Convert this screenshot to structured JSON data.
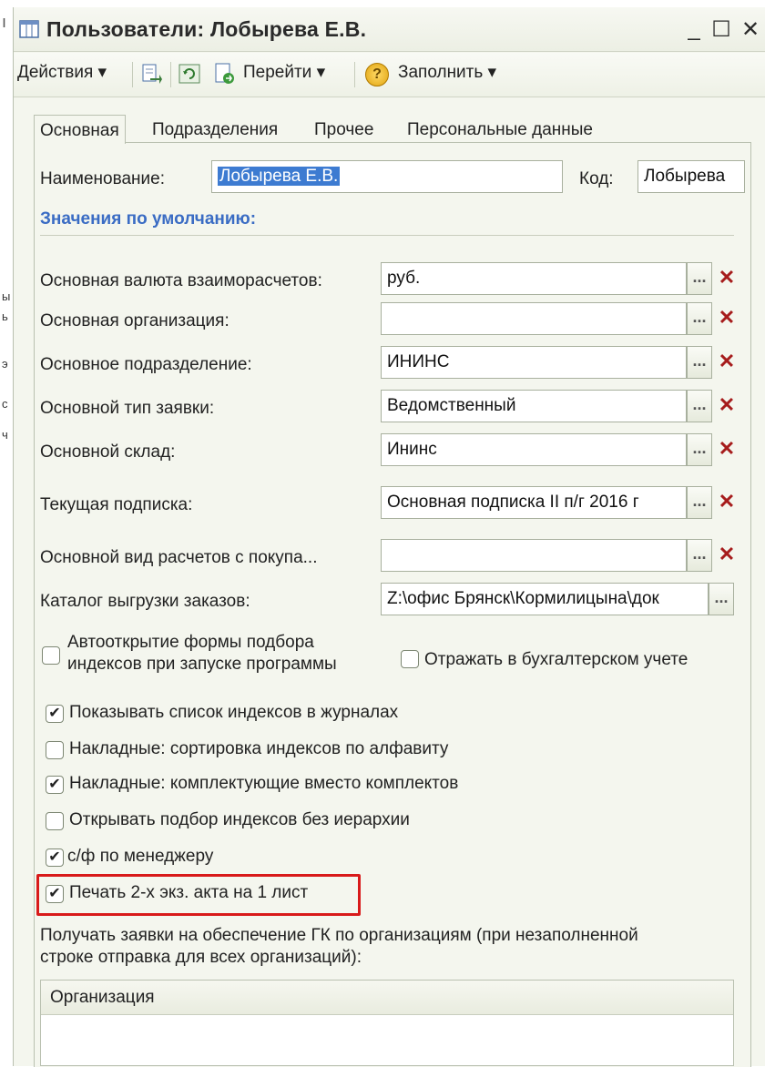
{
  "window": {
    "title": "Пользователи: Лобырева Е.В.",
    "minimize": "_",
    "maximize": "☐",
    "close": "✕"
  },
  "toolbar": {
    "actions": "Действия ▾",
    "goto": "Перейти ▾",
    "fill": "Заполнить ▾",
    "help_glyph": "?"
  },
  "tabs": [
    "Основная",
    "Подразделения",
    "Прочее",
    "Персональные данные"
  ],
  "header": {
    "name_label": "Наименование:",
    "name_value": "Лобырева Е.В.",
    "code_label": "Код:",
    "code_value": "Лобырева"
  },
  "defaults_title": "Значения по умолчанию:",
  "fields": [
    {
      "label": "Основная валюта взаиморасчетов:",
      "value": "руб."
    },
    {
      "label": "Основная организация:",
      "value": ""
    },
    {
      "label": "Основное подразделение:",
      "value": "ИНИНС"
    },
    {
      "label": "Основной тип заявки:",
      "value": "Ведомственный"
    },
    {
      "label": "Основной склад:",
      "value": "Ининс"
    },
    {
      "label": "Текущая подписка:",
      "value": "Основная подписка II п/г 2016 г"
    },
    {
      "label": "Основной вид расчетов с покупа...",
      "value": ""
    },
    {
      "label": "Каталог выгрузки заказов:",
      "value": "Z:\\офис Брянск\\Кормилицына\\док"
    }
  ],
  "dots_label": "...",
  "clear_label": "✕",
  "checkboxes": {
    "autoopen_line1": "Автооткрытие формы подбора",
    "autoopen_line2": "индексов при запуске программы",
    "autoopen_checked": false,
    "accounting": "Отражать в бухгалтерском учете",
    "accounting_checked": false,
    "list": [
      {
        "label": "Показывать список индексов в журналах",
        "checked": true
      },
      {
        "label": "Накладные: сортировка индексов по алфавиту",
        "checked": false
      },
      {
        "label": "Накладные: комплектующие вместо комплектов",
        "checked": true
      },
      {
        "label": "Открывать подбор индексов без иерархии",
        "checked": false
      },
      {
        "label": "с/ф по менеджеру",
        "checked": true
      },
      {
        "label": "Печать 2-х экз. акта на 1 лист",
        "checked": true
      }
    ],
    "check_glyph": "✔"
  },
  "note": {
    "line1": "Получать заявки на обеспечение ГК по организациям (при незаполненной",
    "line2": "строке отправка для всех организаций):"
  },
  "table": {
    "column": "Организация"
  },
  "left_strip": [
    "ы",
    "ь",
    "э",
    "с",
    "ч"
  ]
}
